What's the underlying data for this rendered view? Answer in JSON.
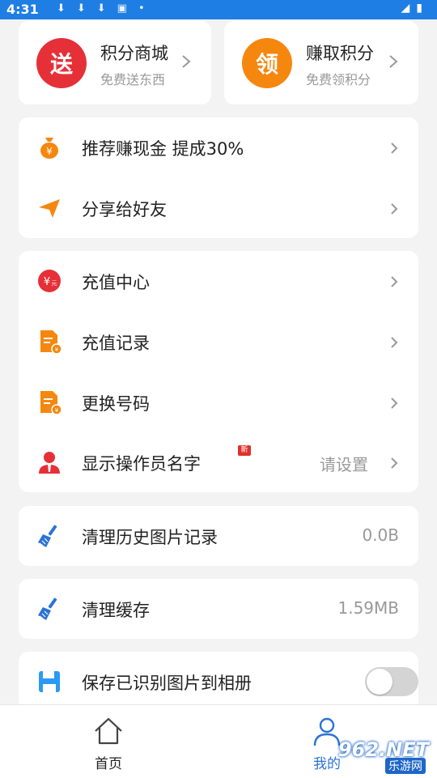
{
  "status_bar": {
    "time": "4:31"
  },
  "top_cards": [
    {
      "badge": "送",
      "title": "积分商城",
      "subtitle": "免费送东西",
      "badge_color": "#e63038"
    },
    {
      "badge": "领",
      "title": "赚取积分",
      "subtitle": "免费领积分",
      "badge_color": "#f5870f"
    }
  ],
  "group1": [
    {
      "label": "推荐赚现金  提成30%",
      "icon": "money-bag-icon"
    },
    {
      "label": "分享给好友",
      "icon": "paper-plane-icon"
    }
  ],
  "group2": [
    {
      "label": "充值中心",
      "icon": "recharge-icon"
    },
    {
      "label": "充值记录",
      "icon": "record-document-icon"
    },
    {
      "label": "更换号码",
      "icon": "change-number-document-icon"
    },
    {
      "label": "显示操作员名字",
      "icon": "operator-avatar-icon",
      "new_tag": "新",
      "value": "请设置"
    }
  ],
  "clear_history": {
    "label": "清理历史图片记录",
    "value": "0.0B",
    "icon": "broom-icon"
  },
  "clear_cache": {
    "label": "清理缓存",
    "value": "1.59MB",
    "icon": "broom-icon"
  },
  "save_images": {
    "label": "保存已识别图片到相册",
    "icon": "floppy-disk-icon",
    "enabled": false
  },
  "tabbar": {
    "tabs": [
      {
        "label": "首页",
        "icon": "home-icon",
        "active": false
      },
      {
        "label": "我的",
        "icon": "profile-icon",
        "active": true
      }
    ]
  },
  "watermark": {
    "brand": "962.NET",
    "sub": "乐游网"
  },
  "colors": {
    "accent_blue": "#2b73d6",
    "status_bar": "#1f7ee3",
    "orange": "#f5870f",
    "red": "#e63038"
  }
}
